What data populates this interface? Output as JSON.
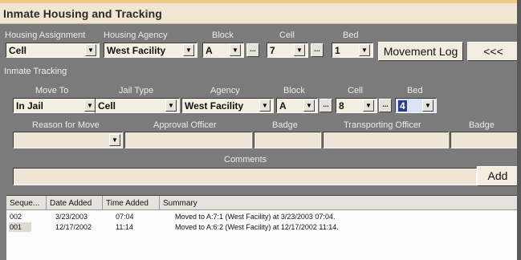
{
  "window": {
    "title": "Inmate Housing and Tracking"
  },
  "housing": {
    "labels": {
      "assignment": "Housing Assignment",
      "agency": "Housing Agency",
      "block": "Block",
      "cell": "Cell",
      "bed": "Bed"
    },
    "assignment": "Cell",
    "agency": "West Facility",
    "block": "A",
    "cell": "7",
    "bed": "1",
    "movement_log_label": "Movement Log",
    "collapse_label": "<<<"
  },
  "tracking": {
    "section_title": "Inmate Tracking",
    "labels": {
      "move_to": "Move To",
      "jail_type": "Jail Type",
      "agency": "Agency",
      "block": "Block",
      "cell": "Cell",
      "bed": "Bed",
      "reason": "Reason for Move",
      "approval_officer": "Approval Officer",
      "badge1": "Badge",
      "transporting_officer": "Transporting Officer",
      "badge2": "Badge",
      "comments": "Comments"
    },
    "move_to": "In Jail",
    "jail_type": "Cell",
    "agency": "West Facility",
    "block": "A",
    "cell": "8",
    "bed": "4",
    "reason": "",
    "approval_officer": "",
    "badge1": "",
    "transporting_officer": "",
    "badge2": "",
    "comments": "",
    "add_label": "Add"
  },
  "log": {
    "columns": [
      "Seque...",
      "Date Added",
      "Time Added",
      "Summary"
    ],
    "rows": [
      {
        "seq": "002",
        "date": "3/23/2003",
        "time": "07:04",
        "summary": "Moved to A:7:1 (West Facility) at 3/23/2003 07:04."
      },
      {
        "seq": "001",
        "date": "12/17/2002",
        "time": "11:14",
        "summary": "Moved to A:6:2 (West Facility) at 12/17/2002 11:14."
      }
    ]
  },
  "icons": {
    "dropdown": "triangle-down-icon",
    "ellipsis": "ellipsis-icon"
  }
}
